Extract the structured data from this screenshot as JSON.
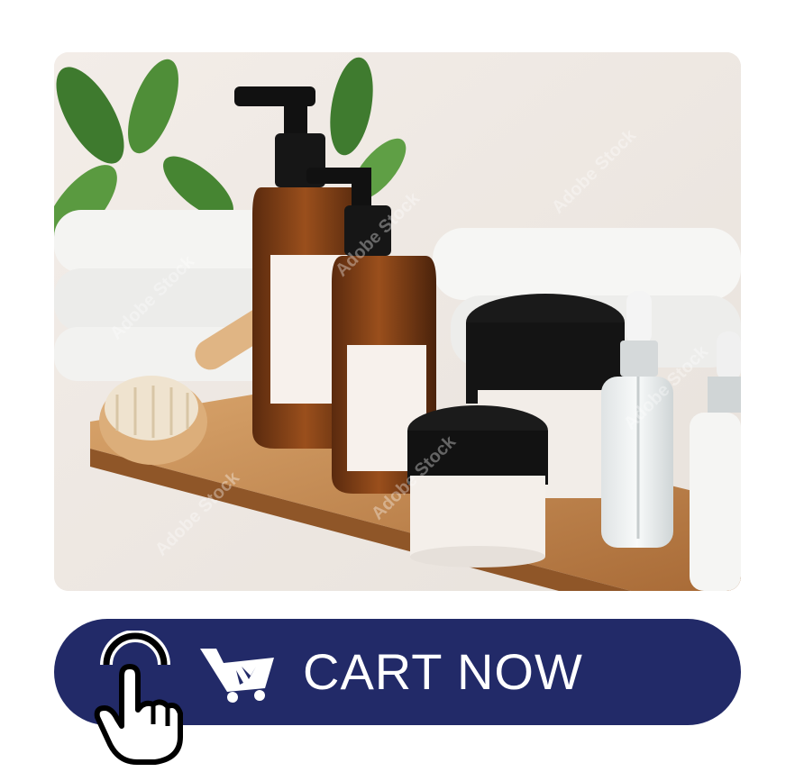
{
  "product": {
    "image_alt": "Amber glass pump bottles, black lid jars and dropper bottles on a wooden tray with towels and a bath brush",
    "watermark": "Adobe Stock"
  },
  "cta": {
    "label": "CART NOW",
    "button_color": "#222a68",
    "text_color": "#ffffff",
    "icons": [
      "cart-icon",
      "pointing-hand-icon"
    ]
  }
}
